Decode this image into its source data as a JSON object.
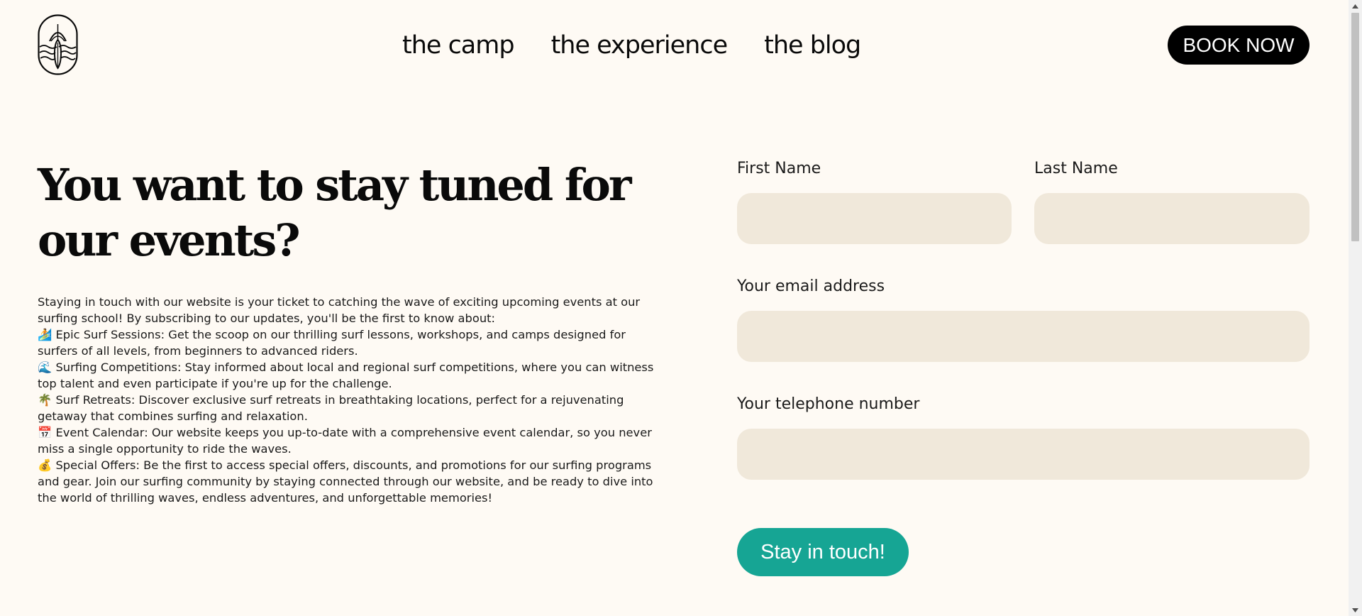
{
  "header": {
    "logo_icon": "surf-camp-logo",
    "nav": [
      "the camp",
      "the experience",
      "the blog"
    ],
    "book_label": "BOOK NOW"
  },
  "hero": {
    "title": "You want to stay tuned for our events?",
    "paragraphs": [
      "Staying in touch with our website is your ticket to catching the wave of exciting upcoming events at our surfing school! By subscribing to our updates, you'll be the first to know about:",
      "🏄 Epic Surf Sessions: Get the scoop on our thrilling surf lessons, workshops, and camps designed for surfers of all levels, from beginners to advanced riders.",
      "🌊 Surfing Competitions: Stay informed about local and regional surf competitions, where you can witness top talent and even participate if you're up for the challenge.",
      "🌴 Surf Retreats: Discover exclusive surf retreats in breathtaking locations, perfect for a rejuvenating getaway that combines surfing and relaxation.",
      "📅 Event Calendar: Our website keeps you up-to-date with a comprehensive event calendar, so you never miss a single opportunity to ride the waves.",
      "💰 Special Offers: Be the first to access special offers, discounts, and promotions for our surfing programs and gear. Join our surfing community by staying connected through our website, and be ready to dive into the world of thrilling waves, endless adventures, and unforgettable memories!"
    ]
  },
  "form": {
    "first_name_label": "First Name",
    "first_name_value": "",
    "last_name_label": "Last Name",
    "last_name_value": "",
    "email_label": "Your email address",
    "email_value": "",
    "phone_label": "Your telephone number",
    "phone_value": "",
    "submit_label": "Stay in touch!"
  },
  "colors": {
    "background": "#fefaf4",
    "input_background": "#f0e8da",
    "accent": "#16a594",
    "book_button": "#000000"
  }
}
